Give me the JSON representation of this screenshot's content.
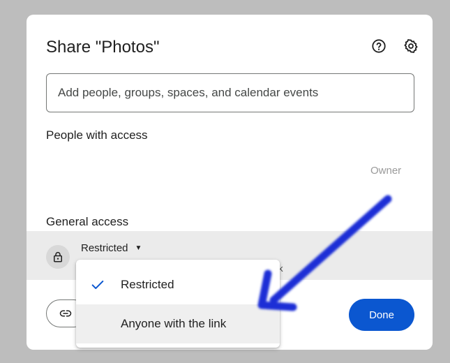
{
  "dialog": {
    "title": "Share \"Photos\"",
    "icons": {
      "help": "help-circle-icon",
      "settings": "gear-icon"
    },
    "add_people": {
      "placeholder": "Add people, groups, spaces, and calendar events"
    },
    "people_with_access": {
      "heading": "People with access",
      "owner_role": "Owner"
    },
    "general_access": {
      "heading": "General access",
      "selected_value": "Restricted",
      "description_fragment": "k"
    },
    "copy_link_icon": "link-icon",
    "done_label": "Done"
  },
  "dropdown": {
    "items": [
      {
        "label": "Restricted",
        "selected": true
      },
      {
        "label": "Anyone with the link",
        "selected": false
      }
    ]
  },
  "annotation": {
    "arrow_color": "#1a2fd6"
  },
  "colors": {
    "accent": "#0b57d0",
    "background": "#bdbdbd"
  }
}
